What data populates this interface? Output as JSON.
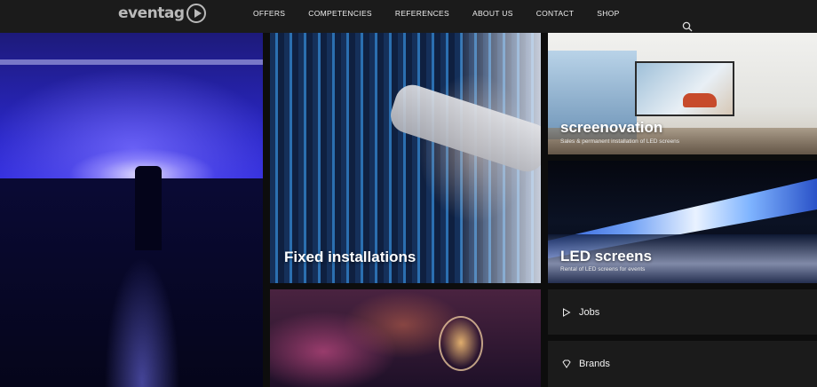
{
  "header": {
    "logo_text": "eventag",
    "nav": [
      "OFFERS",
      "COMPETENCIES",
      "REFERENCES",
      "ABOUT US",
      "CONTACT",
      "SHOP"
    ],
    "search_icon": "search-icon"
  },
  "tiles": {
    "fixed": {
      "title": "Fixed installations"
    },
    "screenovation": {
      "title": "screenovation",
      "subtitle": "Sales & permanent installation of LED screens"
    },
    "led": {
      "title": "LED screens",
      "subtitle": "Rental of LED screens for events"
    }
  },
  "links": {
    "jobs": {
      "label": "Jobs",
      "icon": "play-outline-icon"
    },
    "brands": {
      "label": "Brands",
      "icon": "diamond-outline-icon"
    }
  }
}
